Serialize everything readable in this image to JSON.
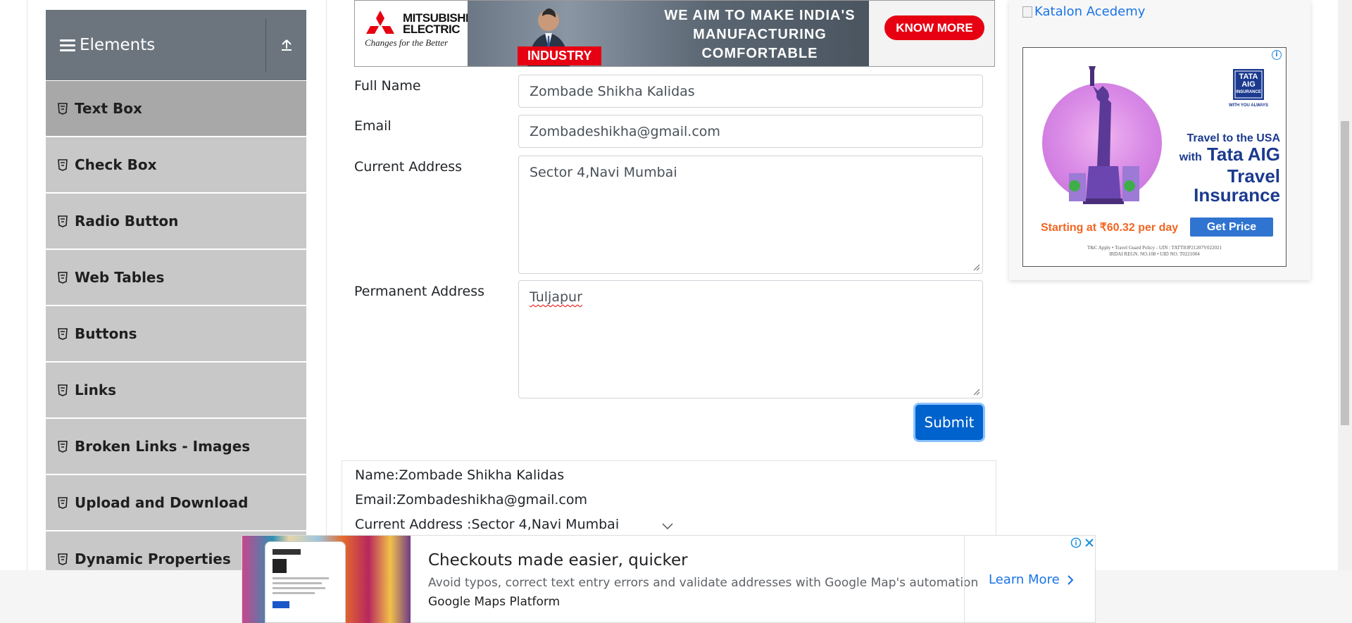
{
  "sidebar": {
    "group_title": "Elements",
    "items": [
      {
        "label": "Text Box"
      },
      {
        "label": "Check Box"
      },
      {
        "label": "Radio Button"
      },
      {
        "label": "Web Tables"
      },
      {
        "label": "Buttons"
      },
      {
        "label": "Links"
      },
      {
        "label": "Broken Links - Images"
      },
      {
        "label": "Upload and Download"
      },
      {
        "label": "Dynamic Properties"
      }
    ]
  },
  "top_ad": {
    "brand": "MITSUBISHI\nELECTRIC",
    "tagline": "Changes for the Better",
    "headline_1": "WE AIM TO MAKE INDIA'S",
    "headline_2": "MANUFACTURING COMFORTABLE",
    "tag": "INDUSTRY",
    "cta": "KNOW MORE"
  },
  "form": {
    "full_name_label": "Full Name",
    "full_name_value": "Zombade Shikha Kalidas",
    "email_label": "Email",
    "email_value": "Zombadeshikha@gmail.com",
    "current_address_label": "Current Address",
    "current_address_value": "Sector 4,Navi Mumbai",
    "permanent_address_label": "Permanent Address",
    "permanent_address_value": "Tuljapur",
    "submit_label": "Submit"
  },
  "output": {
    "name": "Name:Zombade Shikha Kalidas",
    "email": "Email:Zombadeshikha@gmail.com",
    "current_address": "Current Address :Sector 4,Navi Mumbai"
  },
  "right_ads": {
    "katalon_alt": "Katalon Acedemy",
    "tata_brand": "TATA AIG",
    "tata_sub": "INSURANCE",
    "tata_with": "WITH YOU ALWAYS",
    "tata_line1": "Travel to the USA",
    "tata_line2_prefix": "with",
    "tata_line2": "Tata AIG",
    "tata_line3": "Travel",
    "tata_line4": "Insurance",
    "tata_price": "Starting at ₹60.32 per day",
    "tata_cta": "Get Price",
    "tata_fine_1": "T&C Apply • Travel Guard Policy - UIN : TATTIOP21207V022021",
    "tata_fine_2": "IRDAI REGN. NO.108 • UID NO. T0221004"
  },
  "bottom_ad": {
    "title": "Checkouts made easier, quicker",
    "description": "Avoid typos, correct text entry errors and validate addresses with Google Map's automation",
    "source": "Google Maps Platform",
    "cta": "Learn More"
  },
  "colors": {
    "sidebar_header": "#6c757d",
    "menu_item": "#c8c8c8",
    "menu_item_active": "#a8a8a8",
    "submit": "#0062cc",
    "link": "#1a73e8",
    "mitsubishi_red": "#e60012"
  }
}
